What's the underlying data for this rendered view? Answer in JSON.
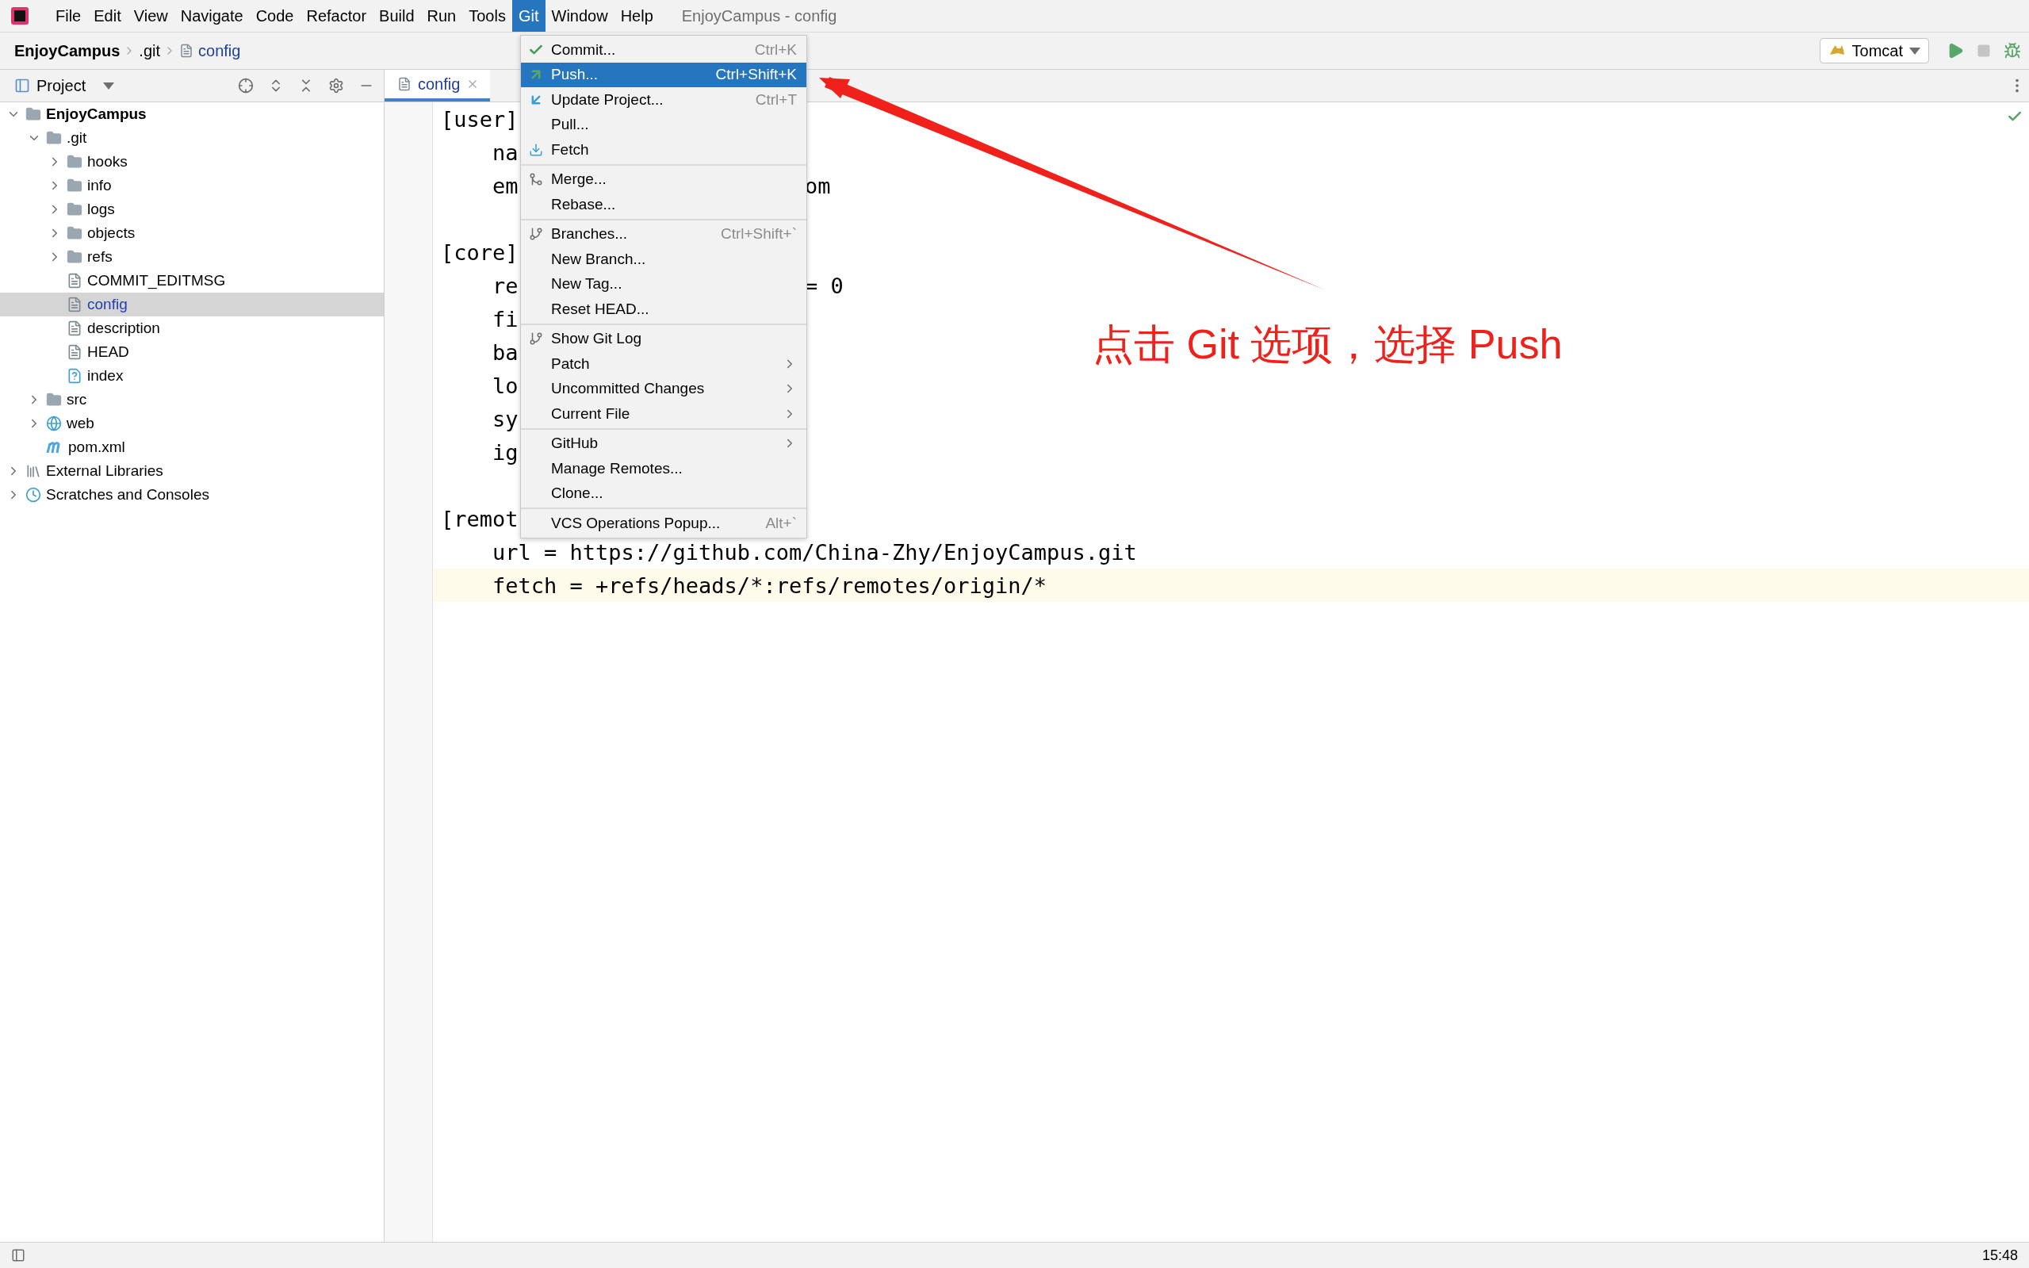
{
  "menu_bar": {
    "items": [
      {
        "label": "File",
        "selected": false
      },
      {
        "label": "Edit",
        "selected": false
      },
      {
        "label": "View",
        "selected": false
      },
      {
        "label": "Navigate",
        "selected": false
      },
      {
        "label": "Code",
        "selected": false
      },
      {
        "label": "Refactor",
        "selected": false
      },
      {
        "label": "Build",
        "selected": false
      },
      {
        "label": "Run",
        "selected": false
      },
      {
        "label": "Tools",
        "selected": false
      },
      {
        "label": "Git",
        "selected": true
      },
      {
        "label": "Window",
        "selected": false
      },
      {
        "label": "Help",
        "selected": false
      }
    ],
    "title": "EnjoyCampus - config"
  },
  "breadcrumb": [
    {
      "label": "EnjoyCampus",
      "kind": "project"
    },
    {
      "label": ".git",
      "kind": "folder"
    },
    {
      "label": "config",
      "kind": "file"
    }
  ],
  "run_config": {
    "label": "Tomcat"
  },
  "project_panel": {
    "title": "Project",
    "tree": [
      {
        "label": "EnjoyCampus",
        "kind": "module",
        "expanded": true,
        "selected": false,
        "children": [
          {
            "label": ".git",
            "kind": "folder",
            "expanded": true,
            "selected": false,
            "children": [
              {
                "label": "hooks",
                "kind": "folder",
                "expanded": false,
                "selected": false
              },
              {
                "label": "info",
                "kind": "folder",
                "expanded": false,
                "selected": false
              },
              {
                "label": "logs",
                "kind": "folder",
                "expanded": false,
                "selected": false
              },
              {
                "label": "objects",
                "kind": "folder",
                "expanded": false,
                "selected": false
              },
              {
                "label": "refs",
                "kind": "folder",
                "expanded": false,
                "selected": false
              },
              {
                "label": "COMMIT_EDITMSG",
                "kind": "file",
                "selected": false
              },
              {
                "label": "config",
                "kind": "file",
                "selected": true
              },
              {
                "label": "description",
                "kind": "file",
                "selected": false
              },
              {
                "label": "HEAD",
                "kind": "file",
                "selected": false
              },
              {
                "label": "index",
                "kind": "unknown",
                "selected": false
              }
            ]
          },
          {
            "label": "src",
            "kind": "folder",
            "expanded": false,
            "selected": false
          },
          {
            "label": "web",
            "kind": "web",
            "expanded": false,
            "selected": false
          },
          {
            "label": "pom.xml",
            "kind": "maven",
            "selected": false
          }
        ]
      },
      {
        "label": "External Libraries",
        "kind": "libraries",
        "expanded": false,
        "selected": false
      },
      {
        "label": "Scratches and Consoles",
        "kind": "scratches",
        "expanded": false,
        "selected": false
      }
    ]
  },
  "editor": {
    "tabs": [
      {
        "label": "config",
        "selected": true
      }
    ],
    "lines": [
      {
        "kind": "text",
        "text": "[user]"
      },
      {
        "kind": "text",
        "text": "    na"
      },
      {
        "kind": "text",
        "text": "    em",
        "tail": "om"
      },
      {
        "kind": "blank"
      },
      {
        "kind": "text",
        "text": "[core]"
      },
      {
        "kind": "text",
        "text": "    re",
        "tail": "= 0"
      },
      {
        "kind": "text",
        "text": "    fi"
      },
      {
        "kind": "text",
        "text": "    ba"
      },
      {
        "kind": "text",
        "text": "    lo"
      },
      {
        "kind": "text",
        "text": "    sy"
      },
      {
        "kind": "text",
        "text": "    ig"
      },
      {
        "kind": "blank"
      },
      {
        "kind": "text",
        "text": "[remot"
      },
      {
        "kind": "text",
        "text": "    url = https://github.com/China-Zhy/EnjoyCampus.git"
      },
      {
        "kind": "text",
        "text": "    fetch = +refs/heads/*:refs/remotes/origin/*",
        "current": true
      }
    ]
  },
  "git_menu": {
    "groups": [
      [
        {
          "label": "Commit...",
          "shortcut": "Ctrl+K",
          "kind": "check",
          "selected": false
        },
        {
          "label": "Push...",
          "shortcut": "Ctrl+Shift+K",
          "kind": "push",
          "selected": true
        },
        {
          "label": "Update Project...",
          "shortcut": "Ctrl+T",
          "kind": "update",
          "selected": false
        },
        {
          "label": "Pull...",
          "kind": "plain",
          "selected": false
        },
        {
          "label": "Fetch",
          "kind": "fetch",
          "selected": false
        }
      ],
      [
        {
          "label": "Merge...",
          "kind": "merge",
          "selected": false
        },
        {
          "label": "Rebase...",
          "kind": "plain",
          "selected": false
        }
      ],
      [
        {
          "label": "Branches...",
          "shortcut": "Ctrl+Shift+`",
          "kind": "branch",
          "selected": false
        },
        {
          "label": "New Branch...",
          "kind": "plain",
          "selected": false
        },
        {
          "label": "New Tag...",
          "kind": "plain",
          "selected": false
        },
        {
          "label": "Reset HEAD...",
          "kind": "plain",
          "selected": false
        }
      ],
      [
        {
          "label": "Show Git Log",
          "kind": "branch",
          "selected": false
        },
        {
          "label": "Patch",
          "kind": "plain",
          "submenu": true,
          "selected": false
        },
        {
          "label": "Uncommitted Changes",
          "kind": "plain",
          "submenu": true,
          "selected": false
        },
        {
          "label": "Current File",
          "kind": "plain",
          "submenu": true,
          "selected": false
        }
      ],
      [
        {
          "label": "GitHub",
          "kind": "plain",
          "submenu": true,
          "selected": false
        },
        {
          "label": "Manage Remotes...",
          "kind": "plain",
          "selected": false
        },
        {
          "label": "Clone...",
          "kind": "plain",
          "selected": false
        }
      ],
      [
        {
          "label": "VCS Operations Popup...",
          "shortcut": "Alt+`",
          "kind": "plain",
          "selected": false
        }
      ]
    ]
  },
  "annotation": {
    "text": "点击 Git 选项，选择 Push"
  },
  "status_bar": {
    "time": "15:48"
  }
}
